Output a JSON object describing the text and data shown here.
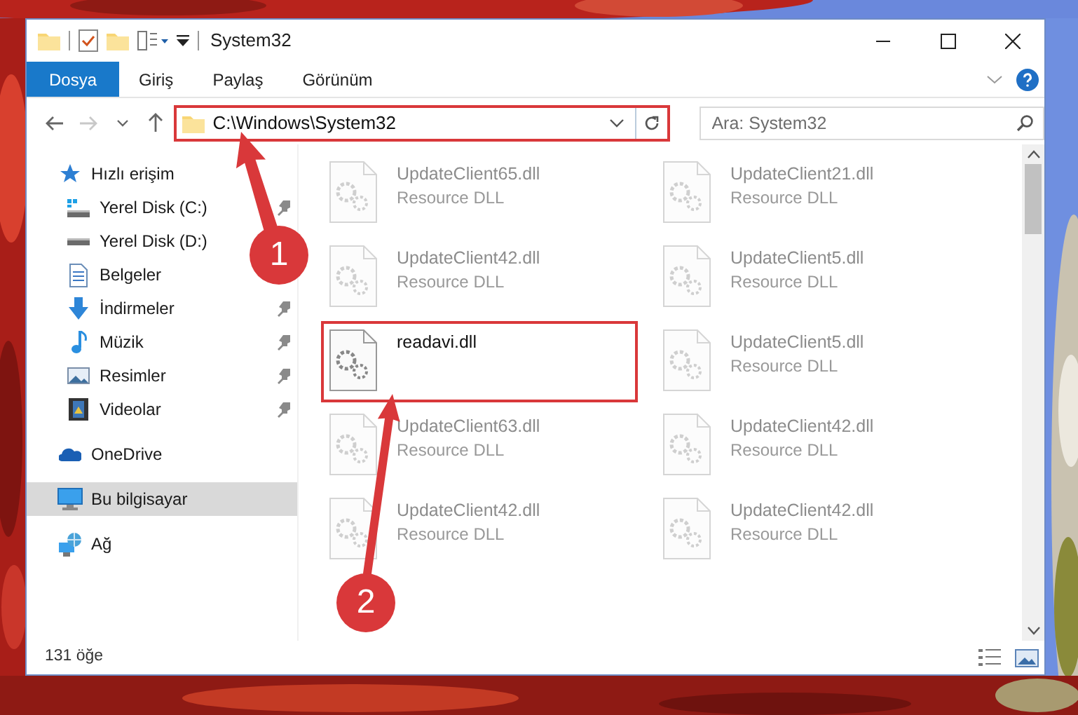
{
  "window": {
    "title": "System32"
  },
  "ribbon_tabs": [
    {
      "label": "Dosya",
      "selected": true
    },
    {
      "label": "Giriş",
      "selected": false
    },
    {
      "label": "Paylaş",
      "selected": false
    },
    {
      "label": "Görünüm",
      "selected": false
    }
  ],
  "nav_buttons": [
    {
      "kind": "back",
      "disabled": false
    },
    {
      "kind": "forward",
      "disabled": true
    },
    {
      "kind": "recent",
      "disabled": false
    },
    {
      "kind": "up",
      "disabled": false
    }
  ],
  "address": {
    "value": "C:\\Windows\\System32",
    "highlighted": true
  },
  "search": {
    "placeholder": "Ara: System32"
  },
  "navigation": [
    {
      "label": "Hızlı erişim",
      "kind": "star",
      "selected": false,
      "children": [
        {
          "label": "Yerel Disk (C:)",
          "kind": "drive-windows",
          "pinned": true,
          "selected": false
        },
        {
          "label": "Yerel Disk (D:)",
          "kind": "drive",
          "selected": false
        },
        {
          "label": "Belgeler",
          "kind": "document",
          "selected": false
        },
        {
          "label": "İndirmeler",
          "kind": "download",
          "pinned": true,
          "selected": false
        },
        {
          "label": "Müzik",
          "kind": "music",
          "pinned": true,
          "selected": false
        },
        {
          "label": "Resimler",
          "kind": "pictures",
          "pinned": true,
          "selected": false
        },
        {
          "label": "Videolar",
          "kind": "video",
          "pinned": true,
          "selected": false
        }
      ]
    },
    {
      "label": "OneDrive",
      "kind": "cloud",
      "selected": false
    },
    {
      "label": "Bu bilgisayar",
      "kind": "computer",
      "selected": true
    },
    {
      "label": "Ağ",
      "kind": "network",
      "selected": false
    }
  ],
  "files": [
    {
      "name": "UpdateClient65.dll",
      "type": "Resource DLL",
      "blurred": true,
      "highlighted": false
    },
    {
      "name": "UpdateClient21.dll",
      "type": "Resource DLL",
      "blurred": true,
      "highlighted": false
    },
    {
      "name": "UpdateClient42.dll",
      "type": "Resource DLL",
      "blurred": true,
      "highlighted": false
    },
    {
      "name": "UpdateClient5.dll",
      "type": "Resource DLL",
      "blurred": true,
      "highlighted": false
    },
    {
      "name": "readavi.dll",
      "blurred": false,
      "highlighted": true
    },
    {
      "name": "UpdateClient5.dll",
      "type": "Resource DLL",
      "blurred": true,
      "highlighted": false
    },
    {
      "name": "UpdateClient63.dll",
      "type": "Resource DLL",
      "blurred": true,
      "highlighted": false
    },
    {
      "name": "UpdateClient42.dll",
      "type": "Resource DLL",
      "blurred": true,
      "highlighted": false
    },
    {
      "name": "UpdateClient42.dll",
      "type": "Resource DLL",
      "blurred": true,
      "highlighted": false
    },
    {
      "name": "UpdateClient42.dll",
      "type": "Resource DLL",
      "blurred": true,
      "highlighted": false
    }
  ],
  "status_bar": {
    "item_count": "131 öğe"
  },
  "annotations": [
    {
      "label": "1"
    },
    {
      "label": "2"
    }
  ]
}
